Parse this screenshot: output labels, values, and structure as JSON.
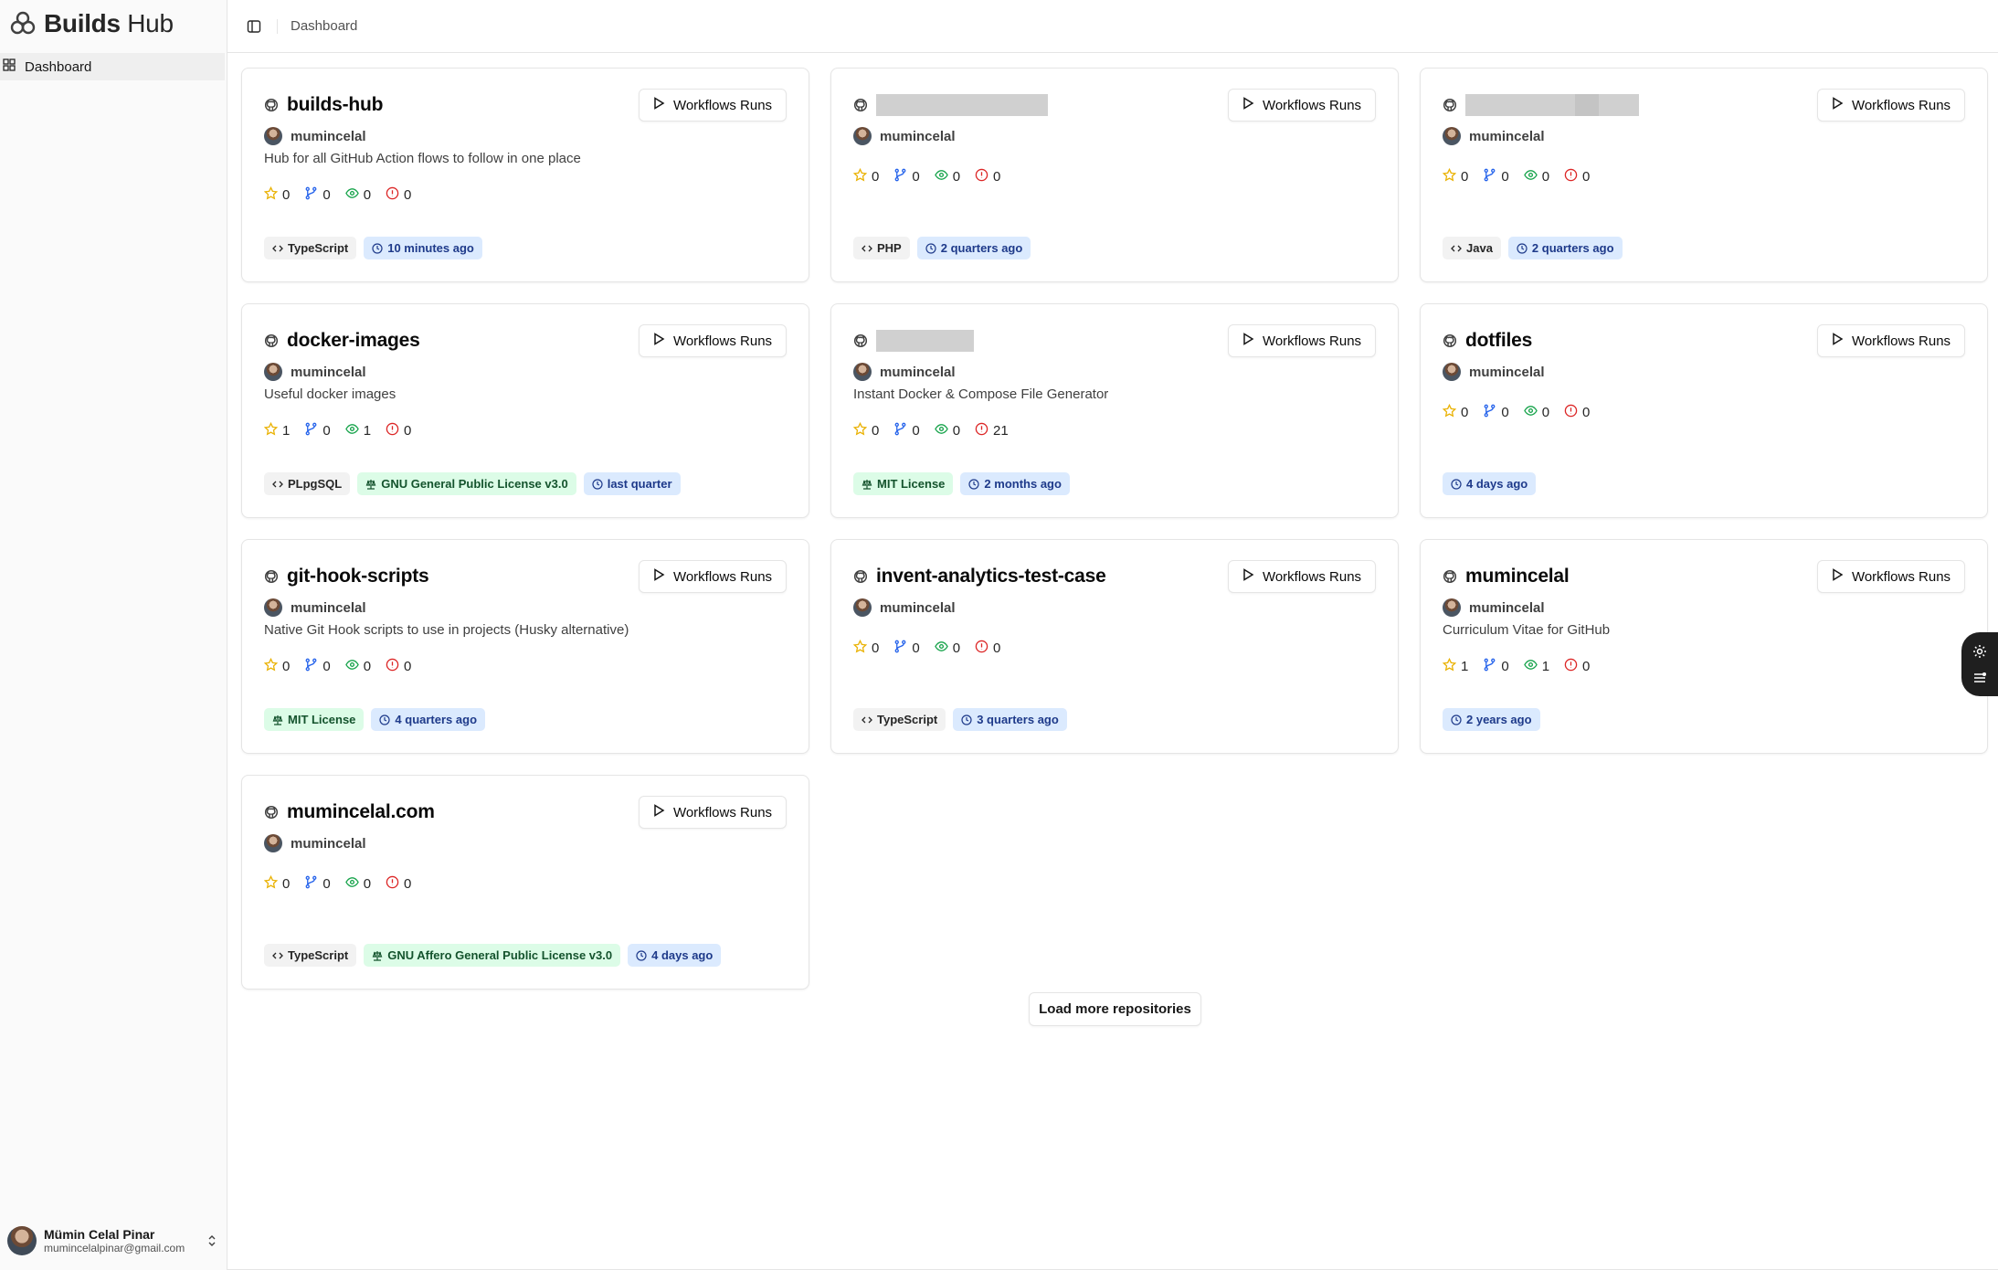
{
  "brand": {
    "bold": "Builds",
    "rest": " Hub"
  },
  "sidebar": {
    "items": [
      {
        "label": "Dashboard",
        "icon": "grid-icon"
      }
    ]
  },
  "user": {
    "name": "Mümin Celal Pinar",
    "email": "mumincelalpinar@gmail.com"
  },
  "header": {
    "breadcrumb": "Dashboard"
  },
  "workflow_label": "Workflows Runs",
  "repos": [
    {
      "name": "builds-hub",
      "owner": "mumincelal",
      "description": "Hub for all GitHub Action flows to follow in one place",
      "stars": "0",
      "forks": "0",
      "watchers": "0",
      "issues": "0",
      "language": "TypeScript",
      "license": "",
      "updated": "10 minutes ago"
    },
    {
      "name": "",
      "owner": "mumincelal",
      "description": "",
      "stars": "0",
      "forks": "0",
      "watchers": "0",
      "issues": "0",
      "language": "PHP",
      "license": "",
      "updated": "2 quarters ago"
    },
    {
      "name": "",
      "owner": "mumincelal",
      "description": "",
      "stars": "0",
      "forks": "0",
      "watchers": "0",
      "issues": "0",
      "language": "Java",
      "license": "",
      "updated": "2 quarters ago"
    },
    {
      "name": "docker-images",
      "owner": "mumincelal",
      "description": "Useful docker images",
      "stars": "1",
      "forks": "0",
      "watchers": "1",
      "issues": "0",
      "language": "PLpgSQL",
      "license": "GNU General Public License v3.0",
      "updated": "last quarter"
    },
    {
      "name": "",
      "owner": "mumincelal",
      "description": "Instant Docker & Compose File Generator",
      "stars": "0",
      "forks": "0",
      "watchers": "0",
      "issues": "21",
      "language": "",
      "license": "MIT License",
      "updated": "2 months ago"
    },
    {
      "name": "dotfiles",
      "owner": "mumincelal",
      "description": "",
      "stars": "0",
      "forks": "0",
      "watchers": "0",
      "issues": "0",
      "language": "",
      "license": "",
      "updated": "4 days ago"
    },
    {
      "name": "git-hook-scripts",
      "owner": "mumincelal",
      "description": "Native Git Hook scripts to use in projects (Husky alternative)",
      "stars": "0",
      "forks": "0",
      "watchers": "0",
      "issues": "0",
      "language": "",
      "license": "MIT License",
      "updated": "4 quarters ago"
    },
    {
      "name": "invent-analytics-test-case",
      "owner": "mumincelal",
      "description": "",
      "stars": "0",
      "forks": "0",
      "watchers": "0",
      "issues": "0",
      "language": "TypeScript",
      "license": "",
      "updated": "3 quarters ago"
    },
    {
      "name": "mumincelal",
      "owner": "mumincelal",
      "description": "Curriculum Vitae for GitHub",
      "stars": "1",
      "forks": "0",
      "watchers": "1",
      "issues": "0",
      "language": "",
      "license": "",
      "updated": "2 years ago"
    },
    {
      "name": "mumincelal.com",
      "owner": "mumincelal",
      "description": "",
      "stars": "0",
      "forks": "0",
      "watchers": "0",
      "issues": "0",
      "language": "TypeScript",
      "license": "GNU Affero General Public License v3.0",
      "updated": "4 days ago"
    }
  ],
  "load_more": "Load more repositories",
  "colors": {
    "star": "#eab308",
    "fork": "#2563eb",
    "watch": "#16a34a",
    "issue": "#dc2626"
  }
}
